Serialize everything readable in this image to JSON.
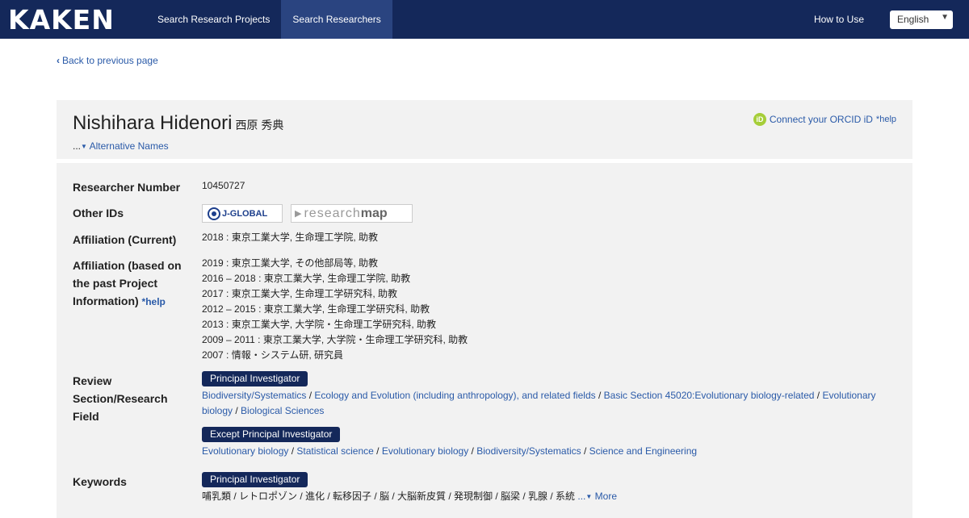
{
  "nav": {
    "logo": "KAKEN",
    "tabs": [
      {
        "label": "Search Research Projects",
        "active": false
      },
      {
        "label": "Search Researchers",
        "active": true
      }
    ],
    "how_to_use": "How to Use",
    "language": "English"
  },
  "back_link": "Back to previous page",
  "researcher": {
    "name": "Nishihara Hidenori",
    "name_ja": "西原 秀典",
    "alt_names_prefix": "...",
    "alt_names_label": "Alternative Names",
    "orcid_label": "Connect your ORCID iD",
    "orcid_help": "*help"
  },
  "details": {
    "researcher_number_label": "Researcher Number",
    "researcher_number": "10450727",
    "other_ids_label": "Other IDs",
    "other_ids": {
      "jglobal": "J-GLOBAL",
      "researchmap_a": "research",
      "researchmap_b": "map"
    },
    "affiliation_current_label": "Affiliation (Current)",
    "affiliation_current": "2018 : 東京工業大学, 生命理工学院, 助教",
    "affiliation_past_label": "Affiliation (based on the past Project Information)",
    "affiliation_past_help": "*help",
    "affiliation_past": [
      "2019 : 東京工業大学, その他部局等, 助教",
      "2016 – 2018 : 東京工業大学, 生命理工学院, 助教",
      "2017 : 東京工業大学, 生命理工学研究科, 助教",
      "2012 – 2015 : 東京工業大学, 生命理工学研究科, 助教",
      "2013 : 東京工業大学, 大学院・生命理工学研究科, 助教",
      "2009 – 2011 : 東京工業大学, 大学院・生命理工学研究科, 助教",
      "2007 : 情報・システム研, 研究員"
    ],
    "review_label": "Review Section/Research Field",
    "pi_badge": "Principal Investigator",
    "pi_fields": [
      "Biodiversity/Systematics",
      "Ecology and Evolution (including anthropology), and related fields",
      "Basic Section 45020:Evolutionary biology-related",
      "Evolutionary biology",
      "Biological Sciences"
    ],
    "except_pi_badge": "Except Principal Investigator",
    "except_pi_fields": [
      "Evolutionary biology",
      "Statistical science",
      "Evolutionary biology",
      "Biodiversity/Systematics",
      "Science and Engineering"
    ],
    "keywords_label": "Keywords",
    "keywords_badge": "Principal Investigator",
    "keywords_text": "哺乳類 / レトロポゾン / 進化 / 転移因子 / 脳 / 大脳新皮質 / 発現制御 / 脳梁 / 乳腺 / 系統",
    "keywords_more_prefix": "...",
    "keywords_more": "More"
  }
}
